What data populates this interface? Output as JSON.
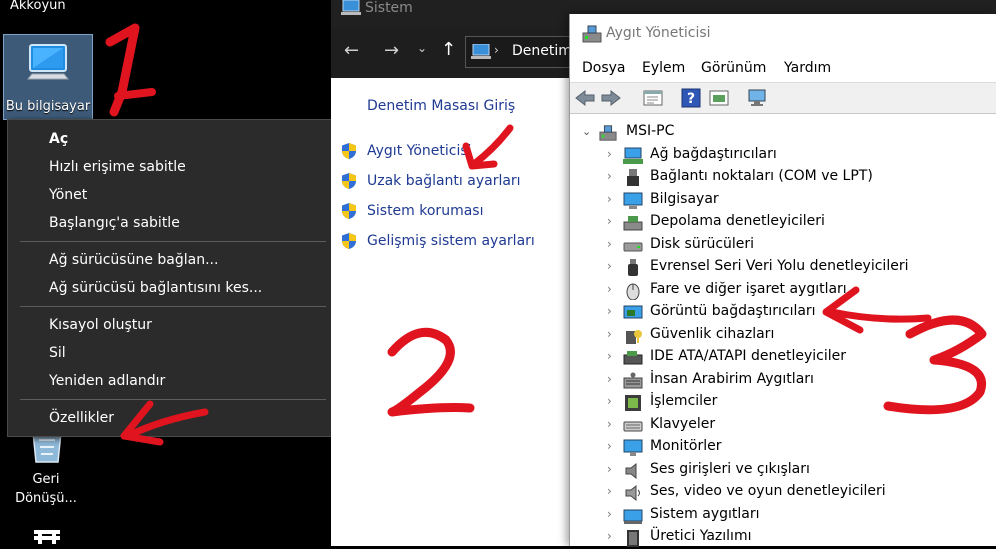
{
  "desktop": {
    "user_folder_label": "Akkoyun",
    "this_pc_label": "Bu bilgisayar",
    "recycle_bin_label": "Geri Dönüşü..."
  },
  "context_menu": {
    "items": [
      {
        "label": "Aç",
        "bold": true
      },
      {
        "label": "Hızlı erişime sabitle"
      },
      {
        "label": "Yönet"
      },
      {
        "label": "Başlangıç'a sabitle"
      },
      {
        "label": "Ağ sürücüsüne bağlan..."
      },
      {
        "label": "Ağ sürücüsü bağlantısını kes..."
      },
      {
        "label": "Kısayol oluştur"
      },
      {
        "label": "Sil"
      },
      {
        "label": "Yeniden adlandır"
      },
      {
        "label": "Özellikler"
      }
    ]
  },
  "sistem_window": {
    "title": "Sistem",
    "address_crumb": "Denetim",
    "home_link": "Denetim Masası Giriş",
    "links": [
      "Aygıt Yöneticisi",
      "Uzak bağlantı ayarları",
      "Sistem koruması",
      "Gelişmiş sistem ayarları"
    ]
  },
  "device_manager": {
    "title": "Aygıt Yöneticisi",
    "menu": [
      "Dosya",
      "Eylem",
      "Görünüm",
      "Yardım"
    ],
    "root": "MSI-PC",
    "categories": [
      {
        "label": "Ağ bağdaştırıcıları",
        "icon": "network-icon"
      },
      {
        "label": "Bağlantı noktaları (COM ve LPT)",
        "icon": "port-icon"
      },
      {
        "label": "Bilgisayar",
        "icon": "computer-icon"
      },
      {
        "label": "Depolama denetleyicileri",
        "icon": "storage-icon"
      },
      {
        "label": "Disk sürücüleri",
        "icon": "disk-icon"
      },
      {
        "label": "Evrensel Seri Veri Yolu denetleyicileri",
        "icon": "usb-icon"
      },
      {
        "label": "Fare ve diğer işaret aygıtları",
        "icon": "mouse-icon"
      },
      {
        "label": "Görüntü bağdaştırıcıları",
        "icon": "display-adapter-icon"
      },
      {
        "label": "Güvenlik cihazları",
        "icon": "security-icon"
      },
      {
        "label": "IDE ATA/ATAPI denetleyiciler",
        "icon": "ide-icon"
      },
      {
        "label": "İnsan Arabirim Aygıtları",
        "icon": "hid-icon"
      },
      {
        "label": "İşlemciler",
        "icon": "processor-icon"
      },
      {
        "label": "Klavyeler",
        "icon": "keyboard-icon"
      },
      {
        "label": "Monitörler",
        "icon": "monitor-icon"
      },
      {
        "label": "Ses girişleri ve çıkışları",
        "icon": "speaker-icon"
      },
      {
        "label": "Ses, video ve oyun denetleyicileri",
        "icon": "sound-icon"
      },
      {
        "label": "Sistem aygıtları",
        "icon": "system-devices-icon"
      },
      {
        "label": "Üretici Yazılımı",
        "icon": "firmware-icon"
      }
    ]
  },
  "colors": {
    "annotation_red": "#e0141e",
    "link_blue": "#1f3a93",
    "menu_bg": "#2b2b2b"
  }
}
